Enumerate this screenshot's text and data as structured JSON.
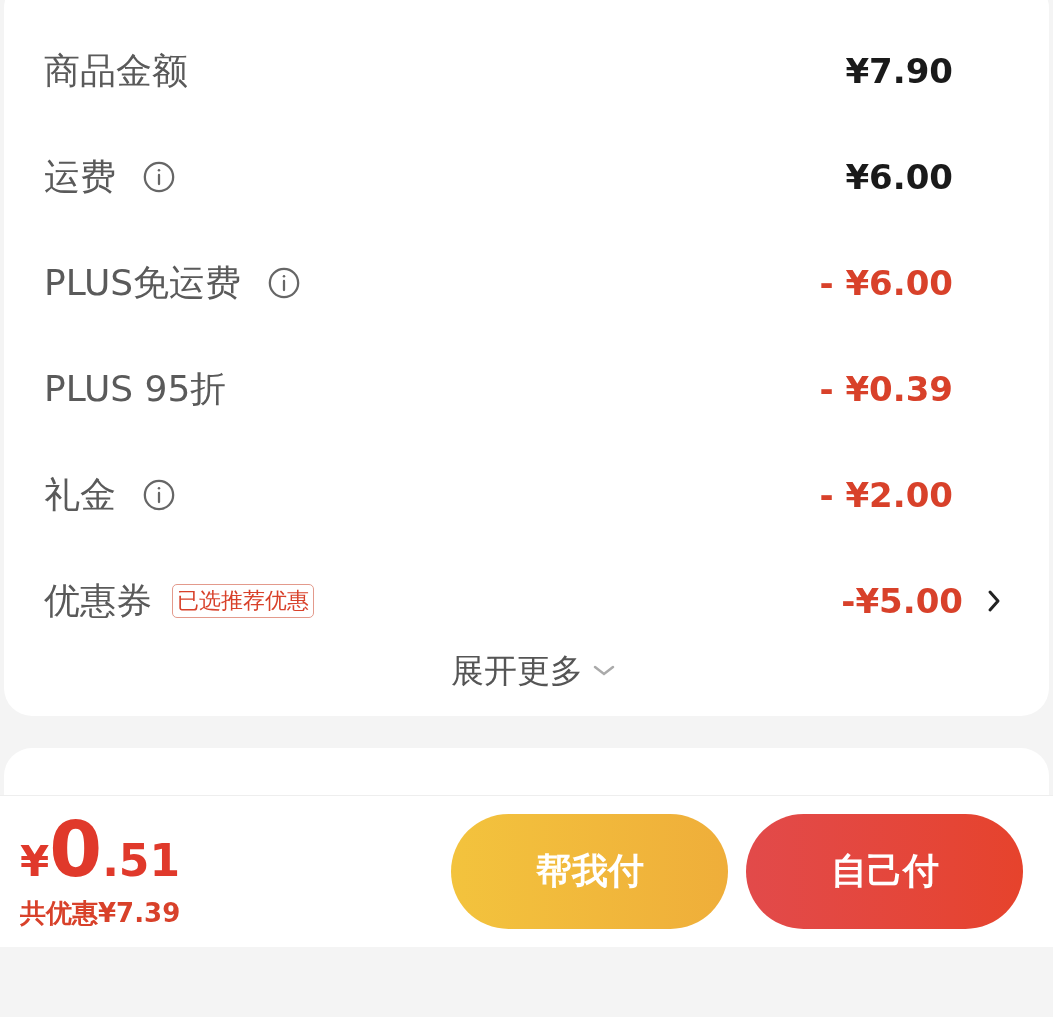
{
  "summary": {
    "rows": [
      {
        "kind": "plain",
        "label": "商品金额",
        "info": false,
        "discount": false,
        "value": "¥7.90"
      },
      {
        "kind": "plain",
        "label": "运费",
        "info": true,
        "discount": false,
        "value": "¥6.00"
      },
      {
        "kind": "plain",
        "label": "PLUS免运费",
        "info": true,
        "discount": true,
        "value": "- ¥6.00"
      },
      {
        "kind": "plain",
        "label": "PLUS 95折",
        "info": false,
        "discount": true,
        "value": "- ¥0.39"
      },
      {
        "kind": "plain",
        "label": "礼金",
        "info": true,
        "discount": true,
        "value": "- ¥2.00"
      },
      {
        "kind": "link",
        "label": "优惠券",
        "info": false,
        "discount": true,
        "tag": "已选推荐优惠",
        "value": "-¥5.00"
      }
    ],
    "expand": "展开更多"
  },
  "footer": {
    "currency": "¥",
    "integer": "0",
    "fraction": ".51",
    "savings": "共优惠¥7.39",
    "buttons": [
      {
        "label": "帮我付",
        "kind": "secondary"
      },
      {
        "label": "自己付",
        "kind": "primary"
      }
    ]
  }
}
